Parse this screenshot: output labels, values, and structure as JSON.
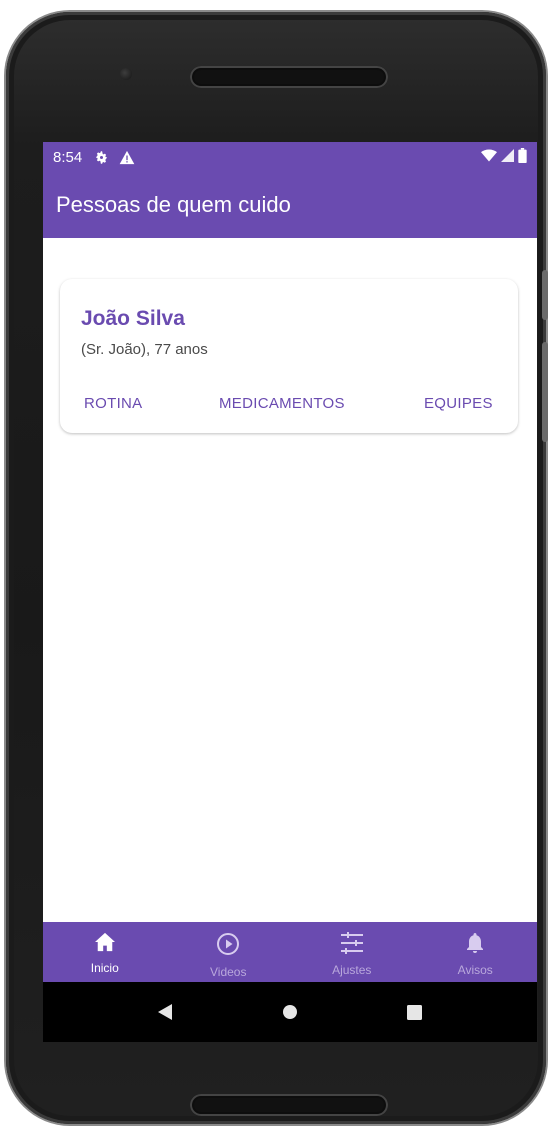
{
  "status_bar": {
    "time": "8:54",
    "icons_left": [
      "gear-icon",
      "warning-icon"
    ],
    "icons_right": [
      "wifi-icon",
      "signal-icon",
      "battery-icon"
    ]
  },
  "app_bar": {
    "title": "Pessoas de quem cuido"
  },
  "card": {
    "name": "João Silva",
    "info": "(Sr. João), 77 anos",
    "actions": [
      "ROTINA",
      "MEDICAMENTOS",
      "EQUIPES"
    ]
  },
  "bottom_nav": {
    "items": [
      {
        "label": "Inicio",
        "icon": "home-icon",
        "active": true
      },
      {
        "label": "Videos",
        "icon": "play-circle-icon",
        "active": false
      },
      {
        "label": "Ajustes",
        "icon": "sliders-icon",
        "active": false
      },
      {
        "label": "Avisos",
        "icon": "bell-icon",
        "active": false
      }
    ]
  },
  "system_nav": {
    "buttons": [
      "back-icon",
      "home-circle-icon",
      "recents-icon"
    ]
  },
  "colors": {
    "primary": "#6a4bb0",
    "inactive_nav": "#b9a8dc",
    "system_nav": "#000000"
  }
}
